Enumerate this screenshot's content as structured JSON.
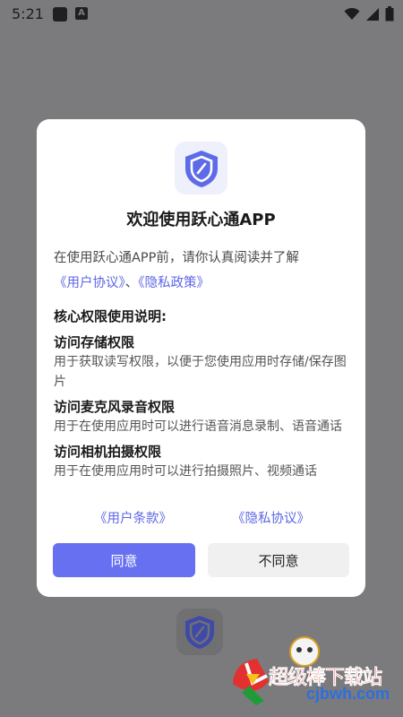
{
  "status_bar": {
    "time": "5:21",
    "a_icon_label": "A",
    "icons": [
      "app-icon",
      "a-icon",
      "wifi-icon",
      "signal-icon",
      "battery-icon"
    ]
  },
  "dialog": {
    "logo_icon": "shield-icon",
    "title": "欢迎使用跃心通APP",
    "intro": "在使用跃心通APP前，请你认真阅读并了解",
    "intro_link_user": "《用户协议》",
    "intro_separator": "、",
    "intro_link_privacy": "《隐私政策》",
    "section_heading": "核心权限使用说明:",
    "permissions": [
      {
        "title": "访问存储权限",
        "desc": "用于获取读写权限，以便于您使用应用时存储/保存图片"
      },
      {
        "title": "访问麦克风录音权限",
        "desc": "用于在使用应用时可以进行语音消息录制、语音通话"
      },
      {
        "title": "访问相机拍摄权限",
        "desc": "用于在使用应用时可以进行拍摄照片、视频通话"
      }
    ],
    "footer_link_terms": "《用户条款》",
    "footer_link_privacy": "《隐私协议》",
    "agree_label": "同意",
    "disagree_label": "不同意"
  },
  "watermark": {
    "text": "超级棒下载站",
    "url": "cjbwh.com"
  },
  "colors": {
    "accent": "#6670f0",
    "link": "#5d66e6",
    "overlay": "#7b7b7d",
    "shield": "#5e6be8"
  }
}
